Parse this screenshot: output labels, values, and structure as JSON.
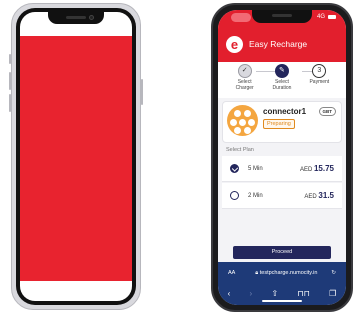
{
  "app": {
    "title": "Easy Recharge",
    "logo_letter": "e",
    "brand_color": "#e21f2d",
    "accent_color": "#23265c"
  },
  "status_bar": {
    "network": "4G"
  },
  "steps": [
    {
      "icon": "check-icon",
      "glyph": "✓",
      "label_line1": "Select",
      "label_line2": "Charger",
      "state": "done"
    },
    {
      "icon": "pencil-icon",
      "glyph": "✎",
      "label_line1": "Select",
      "label_line2": "Duration",
      "state": "active"
    },
    {
      "icon": "step-number",
      "glyph": "3",
      "label_line1": "Payment",
      "label_line2": "",
      "state": "todo"
    }
  ],
  "charger": {
    "name": "connector1",
    "status": "Preparing",
    "type": "GBT",
    "icon": "plug-icon"
  },
  "plans": {
    "title": "Select Plan",
    "items": [
      {
        "duration": "5 Min",
        "currency": "AED",
        "price": "15.75",
        "selected": true
      },
      {
        "duration": "2 Min",
        "currency": "AED",
        "price": "31.5",
        "selected": false
      }
    ]
  },
  "proceed_label": "Proceed",
  "browser": {
    "text_size_label": "AA",
    "lock_icon": "lock-icon",
    "url": "testpcharge.numocity.in",
    "reload_glyph": "↻",
    "toolbar": [
      {
        "icon": "back-icon",
        "glyph": "‹"
      },
      {
        "icon": "forward-icon",
        "glyph": "›"
      },
      {
        "icon": "share-icon",
        "glyph": "⇧"
      },
      {
        "icon": "bookmarks-icon",
        "glyph": "⊓⊓"
      },
      {
        "icon": "tabs-icon",
        "glyph": "❐"
      }
    ]
  },
  "left_phone": {
    "screen_color": "#e8232f"
  }
}
